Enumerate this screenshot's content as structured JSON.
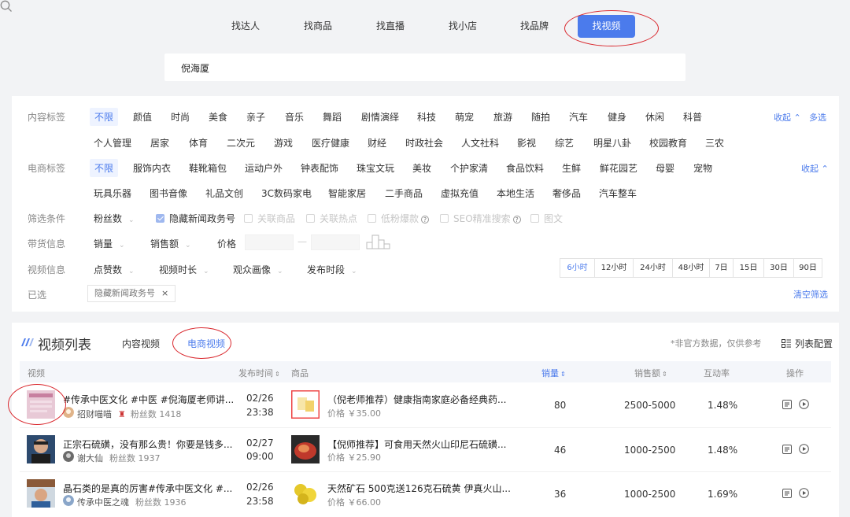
{
  "topnav": {
    "tabs": [
      "找达人",
      "找商品",
      "找直播",
      "找小店",
      "找品牌",
      "找视频"
    ],
    "active_index": 5
  },
  "search": {
    "value": "倪海厦",
    "icon": "search-icon"
  },
  "filters": {
    "content_tags": {
      "label": "内容标签",
      "row1": [
        "不限",
        "颜值",
        "时尚",
        "美食",
        "亲子",
        "音乐",
        "舞蹈",
        "剧情演绎",
        "科技",
        "萌宠",
        "旅游",
        "随拍",
        "汽车",
        "健身",
        "休闲",
        "科普"
      ],
      "row2": [
        "个人管理",
        "居家",
        "体育",
        "二次元",
        "游戏",
        "医疗健康",
        "财经",
        "时政社会",
        "人文社科",
        "影视",
        "综艺",
        "明星八卦",
        "校园教育",
        "三农"
      ],
      "collapse": "收起",
      "multi": "多选"
    },
    "ecom_tags": {
      "label": "电商标签",
      "row1": [
        "不限",
        "服饰内衣",
        "鞋靴箱包",
        "运动户外",
        "钟表配饰",
        "珠宝文玩",
        "美妆",
        "个护家清",
        "食品饮料",
        "生鲜",
        "鲜花园艺",
        "母婴",
        "宠物"
      ],
      "row2": [
        "玩具乐器",
        "图书音像",
        "礼品文创",
        "3C数码家电",
        "智能家居",
        "二手商品",
        "虚拟充值",
        "本地生活",
        "奢侈品",
        "汽车整车"
      ],
      "collapse": "收起"
    },
    "conditions": {
      "label": "筛选条件",
      "dropdown": "粉丝数",
      "checks": [
        {
          "label": "隐藏新闻政务号",
          "checked": true
        },
        {
          "label": "关联商品",
          "checked": false
        },
        {
          "label": "关联热点",
          "checked": false
        },
        {
          "label": "低粉爆款",
          "checked": false,
          "help": "?"
        },
        {
          "label": "SEO精准搜索",
          "checked": false,
          "help": "?"
        },
        {
          "label": "图文",
          "checked": false
        }
      ]
    },
    "goods": {
      "label": "带货信息",
      "sales": "销量",
      "revenue": "销售额",
      "price": "价格",
      "dash": "—"
    },
    "video_info": {
      "label": "视频信息",
      "dropdowns": [
        "点赞数",
        "视频时长",
        "观众画像",
        "发布时段"
      ],
      "time_options": [
        "6小时",
        "12小时",
        "24小时",
        "48小时",
        "7日",
        "15日",
        "30日",
        "90日"
      ]
    },
    "selected": {
      "label": "已选",
      "tag": "隐藏新闻政务号",
      "remove": "×",
      "clear": "清空筛选"
    }
  },
  "list": {
    "title": "视频列表",
    "tabs": [
      "内容视频",
      "电商视频"
    ],
    "active_tab": 1,
    "hint": "*非官方数据，仅供参考",
    "config": "列表配置",
    "columns": {
      "video": "视频",
      "publish": "发布时间",
      "product": "商品",
      "sales": "销量",
      "revenue": "销售额",
      "engagement": "互动率",
      "ops": "操作"
    },
    "sort_glyph": "⇕",
    "rows": [
      {
        "title": "#传承中医文化 #中医 #倪海厦老师讲...",
        "author": "招财喵喵",
        "fans": "粉丝数 1418",
        "date": "02/26",
        "time": "23:38",
        "product": "（倪老师推荐）健康指南家庭必备经典药...",
        "price": "价格 ￥35.00",
        "sales": "80",
        "revenue": "2500-5000",
        "rate": "1.48%"
      },
      {
        "title": "正宗石硫磺，没有那么贵！你要是钱多...",
        "author": "谢大仙",
        "fans": "粉丝数 1937",
        "date": "02/27",
        "time": "09:00",
        "product": "【倪师推荐】可食用天然火山印尼石硫磺...",
        "price": "价格 ￥25.90",
        "sales": "46",
        "revenue": "1000-2500",
        "rate": "1.48%"
      },
      {
        "title": "晶石类的是真的厉害#传承中医文化 #...",
        "author": "传承中医之魂",
        "fans": "粉丝数 1936",
        "date": "02/26",
        "time": "23:58",
        "product": "天然矿石 500克送126克石硫黄 伊真火山...",
        "price": "价格 ￥66.00",
        "sales": "36",
        "revenue": "1000-2500",
        "rate": "1.69%"
      }
    ]
  },
  "colors": {
    "accent": "#4b7bec",
    "highlight_ring": "#d9262c"
  }
}
